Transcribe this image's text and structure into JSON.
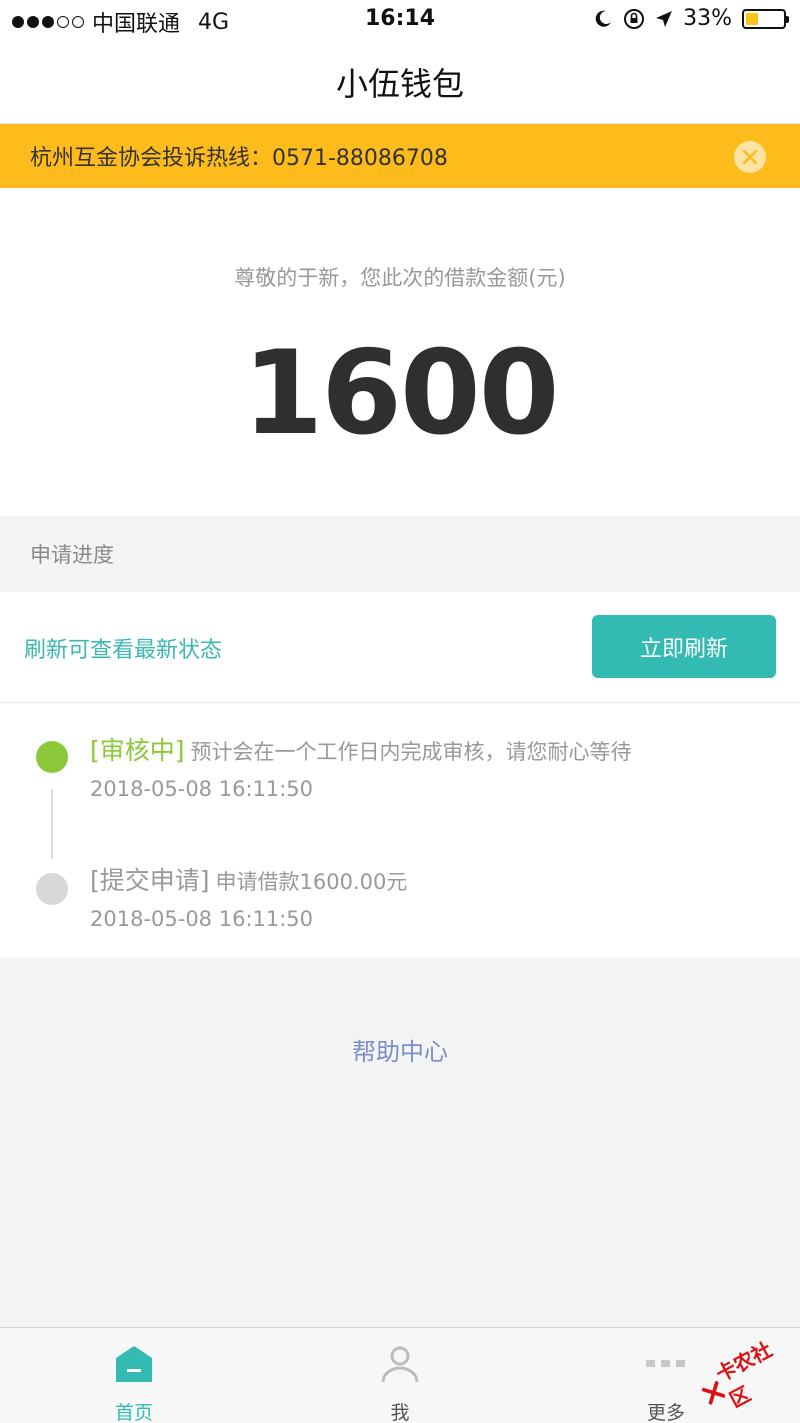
{
  "status_bar": {
    "carrier": "中国联通",
    "network": "4G",
    "time": "16:14",
    "battery": "33%",
    "battery_level": 0.33
  },
  "nav": {
    "title": "小伍钱包"
  },
  "notice": {
    "text": "杭州互金协会投诉热线：0571-88086708"
  },
  "amount": {
    "label": "尊敬的于新，您此次的借款金额(元)",
    "value": "1600"
  },
  "progress": {
    "title": "申请进度",
    "refresh_hint": "刷新可查看最新状态",
    "refresh_button": "立即刷新",
    "items": [
      {
        "status": "[审核中]",
        "desc": "预计会在一个工作日内完成审核，请您耐心等待",
        "time": "2018-05-08 16:11:50"
      },
      {
        "status": "[提交申请]",
        "desc": "申请借款1600.00元",
        "time": "2018-05-08 16:11:50"
      }
    ]
  },
  "help": {
    "label": "帮助中心"
  },
  "tabs": [
    {
      "label": "首页",
      "icon": "home-icon",
      "active": true
    },
    {
      "label": "我",
      "icon": "user-icon",
      "active": false
    },
    {
      "label": "更多",
      "icon": "more-icon",
      "active": false
    }
  ],
  "watermark": {
    "text": "卡农社区"
  },
  "colors": {
    "accent": "#33bab3",
    "notice_bg": "#fdbb1c",
    "active_step": "#8bc93b",
    "link": "#7a8ec8"
  }
}
